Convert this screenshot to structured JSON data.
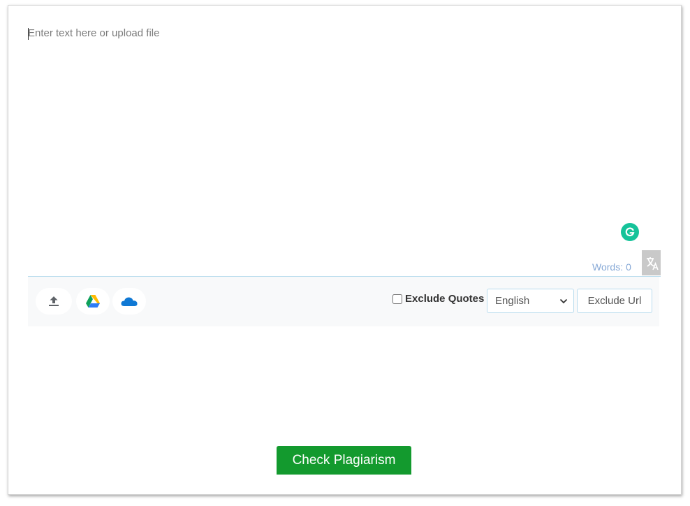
{
  "editor": {
    "placeholder": "Enter text here or upload file",
    "words_label": "Words:",
    "words_count": "0"
  },
  "toolbar": {
    "upload_icon": "upload-icon",
    "google_drive_icon": "google-drive-icon",
    "onedrive_icon": "onedrive-icon",
    "exclude_quotes_label": "Exclude Quotes",
    "exclude_quotes_checked": false,
    "language_selected": "English",
    "exclude_url_label": "Exclude Url"
  },
  "actions": {
    "check_label": "Check Plagiarism"
  },
  "colors": {
    "accent_green": "#139a2e",
    "grammarly_green": "#15c39a",
    "words_blue": "#86a8d6",
    "border_blue": "#b9dcee"
  }
}
